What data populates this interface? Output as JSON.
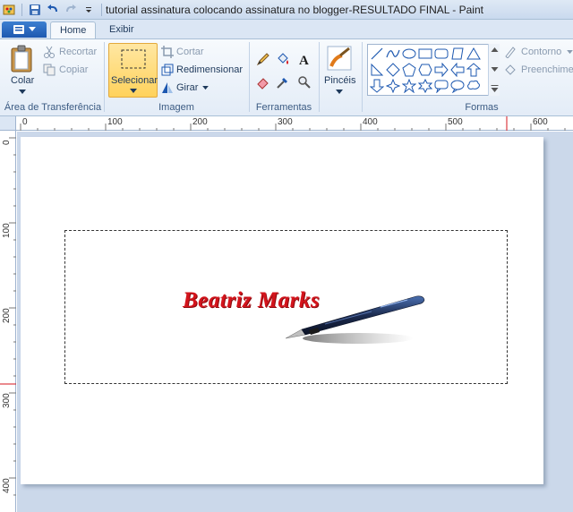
{
  "window": {
    "title": "tutorial assinatura colocando assinatura no blogger-RESULTADO FINAL - Paint"
  },
  "tabs": [
    {
      "label": "Home",
      "active": true
    },
    {
      "label": "Exibir",
      "active": false
    }
  ],
  "ribbon": {
    "clipboard": {
      "paste_label": "Colar",
      "cut_label": "Recortar",
      "copy_label": "Copiar",
      "group_label": "Área de Transferência"
    },
    "image": {
      "select_label": "Selecionar",
      "crop_label": "Cortar",
      "resize_label": "Redimensionar",
      "rotate_label": "Girar",
      "group_label": "Imagem"
    },
    "tools": {
      "group_label": "Ferramentas"
    },
    "brushes": {
      "label": "Pincéis"
    },
    "shapes": {
      "outline_label": "Contorno",
      "fill_label": "Preenchime",
      "group_label": "Formas"
    }
  },
  "rulers": {
    "horizontal": [
      "0",
      "100",
      "200",
      "300",
      "400",
      "500",
      "600"
    ],
    "vertical": [
      "0",
      "100",
      "200",
      "300",
      "400"
    ]
  },
  "canvas": {
    "signature_text": "Beatriz Marks"
  },
  "colors": {
    "selected_button_bg": "#ffd25c",
    "signature": "#d4141c",
    "workspace": "#cbd8ea"
  }
}
